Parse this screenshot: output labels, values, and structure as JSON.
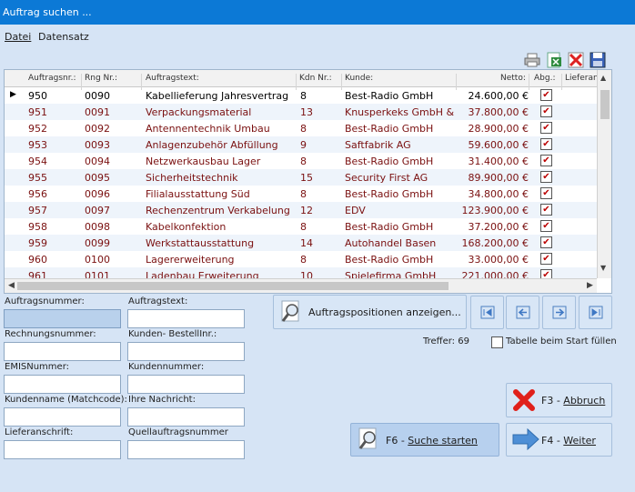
{
  "window": {
    "title": "Auftrag suchen ..."
  },
  "menu": [
    "Datei",
    "Datensatz"
  ],
  "toolbar": [
    "printer-icon",
    "export-excel-icon",
    "delete-icon",
    "save-icon"
  ],
  "grid": {
    "columns": [
      "Auftragsnr.:",
      "Rng Nr.:",
      "Auftragstext:",
      "Kdn Nr.:",
      "Kunde:",
      "Netto:",
      "Abg.:",
      "Lieferans"
    ],
    "rows": [
      {
        "nr": "950",
        "rng": "0090",
        "text": "Kabellieferung Jahresvertrag",
        "kdn": "8",
        "kunde": "Best-Radio GmbH",
        "netto": "24.600,00 €",
        "abg": true
      },
      {
        "nr": "951",
        "rng": "0091",
        "text": "Verpackungsmaterial",
        "kdn": "13",
        "kunde": "Knusperkeks GmbH &",
        "netto": "37.800,00 €",
        "abg": true
      },
      {
        "nr": "952",
        "rng": "0092",
        "text": "Antennentechnik Umbau",
        "kdn": "8",
        "kunde": "Best-Radio GmbH",
        "netto": "28.900,00 €",
        "abg": true
      },
      {
        "nr": "953",
        "rng": "0093",
        "text": "Anlagenzubehör Abfüllung",
        "kdn": "9",
        "kunde": "Saftfabrik AG",
        "netto": "59.600,00 €",
        "abg": true
      },
      {
        "nr": "954",
        "rng": "0094",
        "text": "Netzwerkausbau Lager",
        "kdn": "8",
        "kunde": "Best-Radio GmbH",
        "netto": "31.400,00 €",
        "abg": true
      },
      {
        "nr": "955",
        "rng": "0095",
        "text": "Sicherheitstechnik",
        "kdn": "15",
        "kunde": "Security First AG",
        "netto": "89.900,00 €",
        "abg": true
      },
      {
        "nr": "956",
        "rng": "0096",
        "text": "Filialausstattung Süd",
        "kdn": "8",
        "kunde": "Best-Radio GmbH",
        "netto": "34.800,00 €",
        "abg": true
      },
      {
        "nr": "957",
        "rng": "0097",
        "text": "Rechenzentrum Verkabelung",
        "kdn": "12",
        "kunde": "EDV",
        "netto": "123.900,00 €",
        "abg": true
      },
      {
        "nr": "958",
        "rng": "0098",
        "text": "Kabelkonfektion",
        "kdn": "8",
        "kunde": "Best-Radio GmbH",
        "netto": "37.200,00 €",
        "abg": true
      },
      {
        "nr": "959",
        "rng": "0099",
        "text": "Werkstattausstattung",
        "kdn": "14",
        "kunde": "Autohandel Basen",
        "netto": "168.200,00 €",
        "abg": true
      },
      {
        "nr": "960",
        "rng": "0100",
        "text": "Lagererweiterung",
        "kdn": "8",
        "kunde": "Best-Radio GmbH",
        "netto": "33.000,00 €",
        "abg": true
      },
      {
        "nr": "961",
        "rng": "0101",
        "text": "Ladenbau Erweiterung",
        "kdn": "10",
        "kunde": "Spielefirma GmbH",
        "netto": "221.000,00 €",
        "abg": true
      }
    ]
  },
  "form": {
    "auftragsnummer": {
      "label": "Auftragsnummer:",
      "value": ""
    },
    "auftragstext": {
      "label": "Auftragstext:",
      "value": ""
    },
    "rechnungsnummer": {
      "label": "Rechnungsnummer:",
      "value": ""
    },
    "kunden_bestellnr": {
      "label": "Kunden- BestellInr.:",
      "value": ""
    },
    "emisnummer": {
      "label": "EMISNummer:",
      "value": ""
    },
    "kundennummer": {
      "label": "Kundennummer:",
      "value": ""
    },
    "kundenname": {
      "label": "Kundenname (Matchcode):",
      "value": ""
    },
    "ihre_nachricht": {
      "label": "Ihre Nachricht:",
      "value": ""
    },
    "lieferanschrift": {
      "label": "Lieferanschrift:",
      "value": ""
    },
    "quellauftrag": {
      "label": "Quellauftragsnummer",
      "value": ""
    }
  },
  "buttons": {
    "positionen": "Auftragspositionen  anzeigen...",
    "suche_prefix": "F6 - ",
    "suche_main": "Suche starten",
    "abbruch_prefix": "F3 - ",
    "abbruch_main": "Abbruch",
    "weiter_prefix": "F4 - ",
    "weiter_main": "Weiter"
  },
  "status": {
    "treffer": "Treffer: 69",
    "tabelle_label": "Tabelle beim Start füllen",
    "tabelle_checked": false
  },
  "colors": {
    "titlebar": "#0c79d6",
    "background": "#d6e4f5",
    "row_text": "#7a1010",
    "check": "#b00000"
  }
}
